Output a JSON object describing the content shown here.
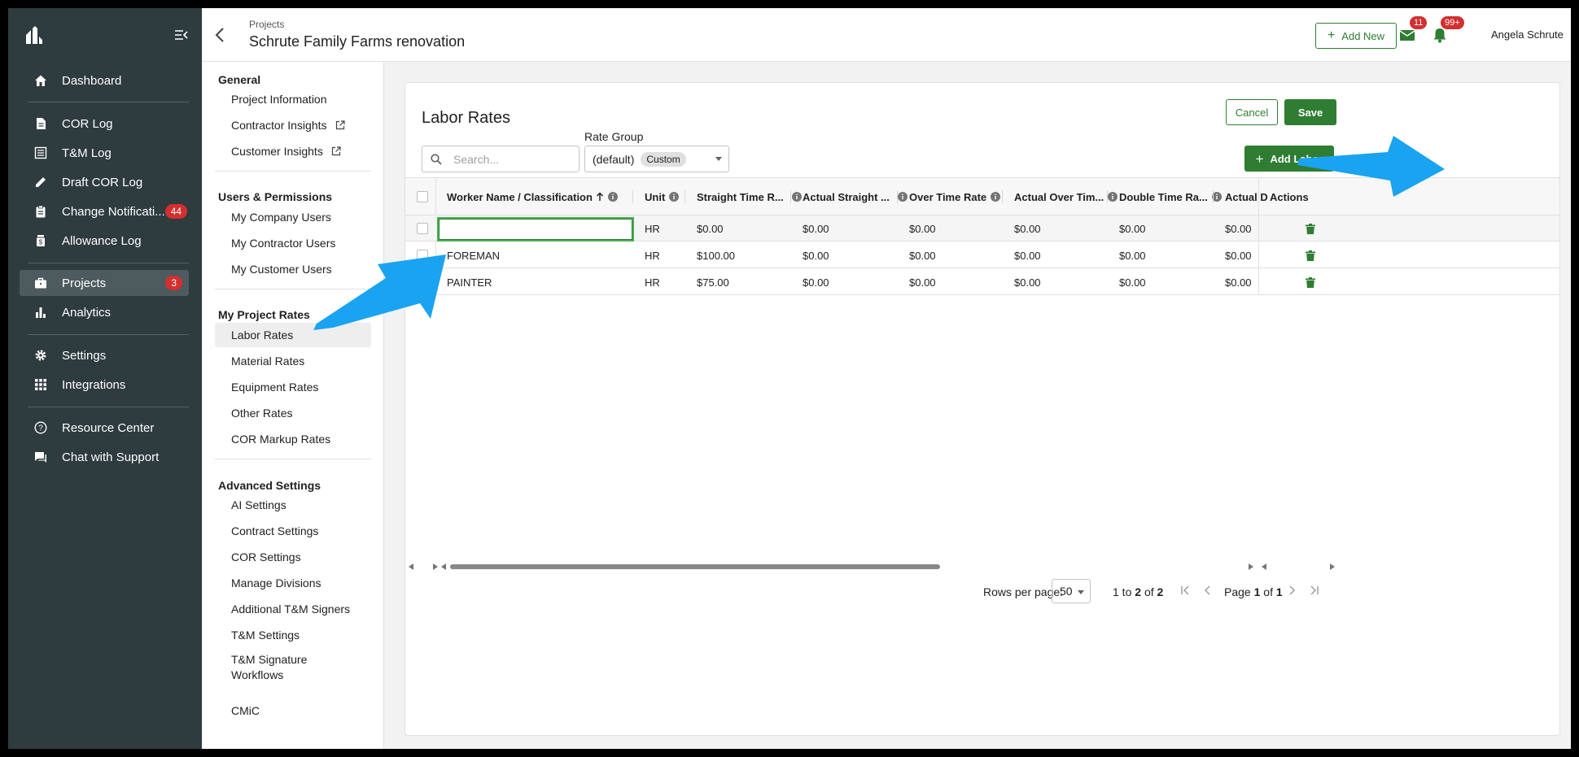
{
  "sidebar": {
    "items": [
      {
        "label": "Dashboard",
        "icon": "home-icon"
      },
      {
        "label": "COR Log",
        "icon": "document-icon"
      },
      {
        "label": "T&M Log",
        "icon": "list-icon"
      },
      {
        "label": "Draft COR Log",
        "icon": "pencil-icon"
      },
      {
        "label": "Change Notificati...",
        "icon": "clipboard-icon",
        "badge": "44"
      },
      {
        "label": "Allowance Log",
        "icon": "jar-icon"
      },
      {
        "label": "Projects",
        "icon": "briefcase-icon",
        "badge": "3",
        "active": true
      },
      {
        "label": "Analytics",
        "icon": "bar-chart-icon"
      },
      {
        "label": "Settings",
        "icon": "gear-icon"
      },
      {
        "label": "Integrations",
        "icon": "grid-icon"
      },
      {
        "label": "Resource Center",
        "icon": "help-icon"
      },
      {
        "label": "Chat with Support",
        "icon": "chat-icon"
      }
    ]
  },
  "header": {
    "breadcrumb": "Projects",
    "title": "Schrute Family Farms renovation",
    "add_new_label": "Add New",
    "mail_count": "11",
    "notification_count": "99+",
    "user_name": "Angela Schrute"
  },
  "settings_nav": {
    "sections": [
      {
        "title": "General",
        "items": [
          "Project Information",
          "Contractor Insights",
          "Customer Insights"
        ]
      },
      {
        "title": "Users & Permissions",
        "items": [
          "My Company Users",
          "My Contractor Users",
          "My Customer Users"
        ]
      },
      {
        "title": "My Project Rates",
        "items": [
          "Labor Rates",
          "Material Rates",
          "Equipment Rates",
          "Other Rates",
          "COR Markup Rates"
        ]
      },
      {
        "title": "Advanced Settings",
        "items": [
          "AI Settings",
          "Contract Settings",
          "COR Settings",
          "Manage Divisions",
          "Additional T&M Signers",
          "T&M Settings",
          "T&M Signature Workflows",
          "CMiC"
        ]
      }
    ]
  },
  "card": {
    "title": "Labor Rates",
    "cancel_label": "Cancel",
    "save_label": "Save",
    "add_labor_label": "Add Labor",
    "search_placeholder": "Search...",
    "rate_group_label": "Rate Group",
    "rate_group_value": "(default)",
    "rate_group_chip": "Custom"
  },
  "table": {
    "columns": [
      "Worker Name / Classification",
      "Unit",
      "Straight Time R...",
      "Actual Straight ...",
      "Over Time Rate",
      "Actual Over Tim...",
      "Double Time Ra...",
      "Actual D",
      "Actions"
    ],
    "rows": [
      {
        "name": "",
        "unit": "HR",
        "st": "$0.00",
        "ast": "$0.00",
        "ot": "$0.00",
        "aot": "$0.00",
        "dt": "$0.00",
        "adt": "$0.00"
      },
      {
        "name": "FOREMAN",
        "unit": "HR",
        "st": "$100.00",
        "ast": "$0.00",
        "ot": "$0.00",
        "aot": "$0.00",
        "dt": "$0.00",
        "adt": "$0.00"
      },
      {
        "name": "PAINTER",
        "unit": "HR",
        "st": "$75.00",
        "ast": "$0.00",
        "ot": "$0.00",
        "aot": "$0.00",
        "dt": "$0.00",
        "adt": "$0.00"
      }
    ]
  },
  "pagination": {
    "rows_per_page_label": "Rows per page:",
    "rows_per_page_value": "50",
    "range_start": "1",
    "range_end": "2",
    "total": "2",
    "page_current": "1",
    "page_total": "1"
  },
  "colors": {
    "sidebar_bg": "#2e3b3f",
    "accent_green": "#2e7d32",
    "badge_red": "#d32f2f",
    "annotation_blue": "#1aa3f0"
  }
}
